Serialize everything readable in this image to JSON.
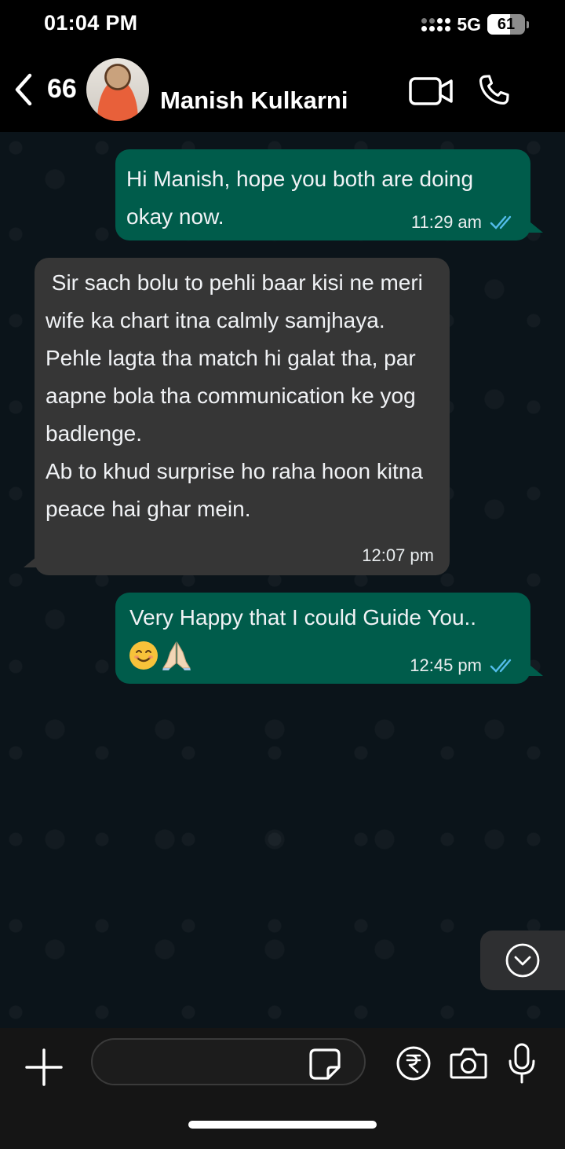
{
  "status_bar": {
    "time": "01:04 PM",
    "network": "5G",
    "battery": "61",
    "battery_level": 0.61
  },
  "header": {
    "back_count": "66",
    "contact_name": "Manish Kulkarni",
    "icons": [
      "back-chevron-icon",
      "video-call-icon",
      "phone-icon"
    ]
  },
  "messages": [
    {
      "direction": "outgoing",
      "text": "Hi Manish, hope you both are doing okay now.",
      "time": "11:29 am",
      "status": "read"
    },
    {
      "direction": "incoming",
      "text": " Sir sach bolu to pehli baar kisi ne meri wife ka chart itna calmly samjhaya.\nPehle lagta tha match hi galat tha, par aapne bola tha communication ke yog badlenge.\nAb to khud surprise ho raha hoon kitna peace hai ghar mein.",
      "time": "12:07 pm"
    },
    {
      "direction": "outgoing",
      "text": "Very Happy that I could Guide You..",
      "emojis": [
        "smiling-face-emoji",
        "folded-hands-emoji"
      ],
      "time": "12:45 pm",
      "status": "read"
    }
  ],
  "input_bar": {
    "placeholder": "",
    "icons": [
      "plus-icon",
      "sticker-icon",
      "rupee-icon",
      "camera-icon",
      "mic-icon"
    ]
  },
  "colors": {
    "outgoing_bubble": "#005c4b",
    "incoming_bubble": "#363636",
    "read_ticks": "#53bdeb",
    "chat_background": "#0b141a"
  }
}
